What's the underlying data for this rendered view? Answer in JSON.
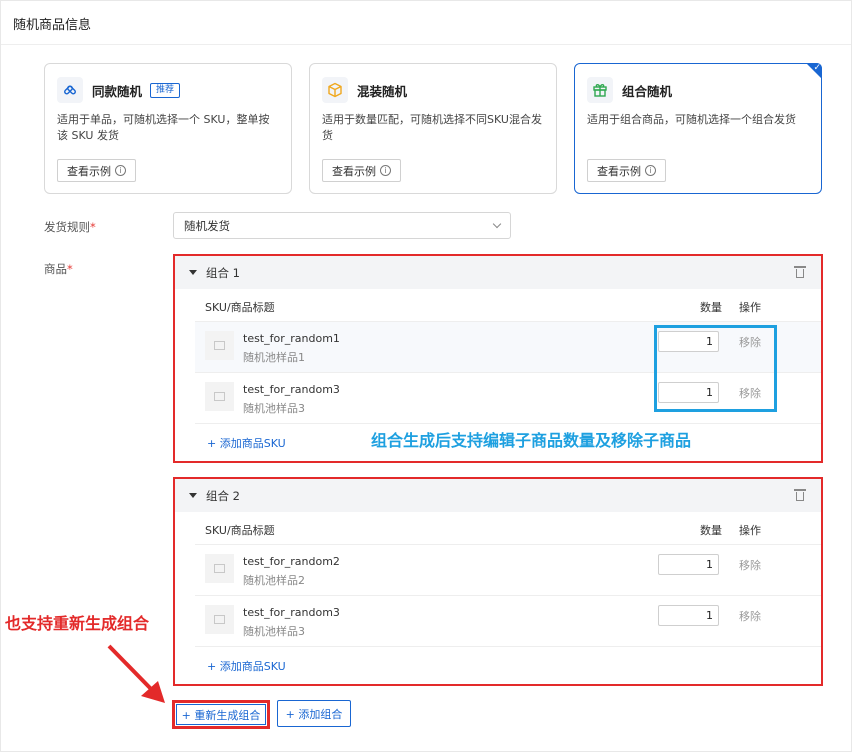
{
  "header": {
    "title": "随机商品信息"
  },
  "cards": [
    {
      "title": "同款随机",
      "badge": "推荐",
      "desc": "适用于单品，可随机选择一个 SKU，整单按该 SKU 发货",
      "button": "查看示例",
      "icon": "link-icon",
      "icon_color": "#1966d2",
      "selected": false
    },
    {
      "title": "混装随机",
      "badge": "",
      "desc": "适用于数量匹配，可随机选择不同SKU混合发货",
      "button": "查看示例",
      "icon": "box-icon",
      "icon_color": "#f0a81e",
      "selected": false
    },
    {
      "title": "组合随机",
      "badge": "",
      "desc": "适用于组合商品，可随机选择一个组合发货",
      "button": "查看示例",
      "icon": "gift-icon",
      "icon_color": "#2fa84f",
      "selected": true
    }
  ],
  "form": {
    "rule_label": "发货规则",
    "rule_value": "随机发货",
    "product_label": "商品",
    "required_mark": "*"
  },
  "table": {
    "col_title": "SKU/商品标题",
    "col_qty": "数量",
    "col_action": "操作",
    "remove_label": "移除",
    "add_sku_label": "+ 添加商品SKU"
  },
  "groups": [
    {
      "name": "组合 1",
      "items": [
        {
          "title": "test_for_random1",
          "subtitle": "随机池样品1",
          "qty": "1"
        },
        {
          "title": "test_for_random3",
          "subtitle": "随机池样品3",
          "qty": "1"
        }
      ]
    },
    {
      "name": "组合 2",
      "items": [
        {
          "title": "test_for_random2",
          "subtitle": "随机池样品2",
          "qty": "1"
        },
        {
          "title": "test_for_random3",
          "subtitle": "随机池样品3",
          "qty": "1"
        }
      ]
    }
  ],
  "annotations": {
    "blue": "组合生成后支持编辑子商品数量及移除子商品",
    "red": "也支持重新生成组合"
  },
  "buttons": {
    "regenerate": "+ 重新生成组合",
    "add_group": "+ 添加组合"
  },
  "colors": {
    "primary": "#1966d2",
    "annotation_red": "#e32a2a",
    "annotation_blue": "#1ea0e0"
  }
}
